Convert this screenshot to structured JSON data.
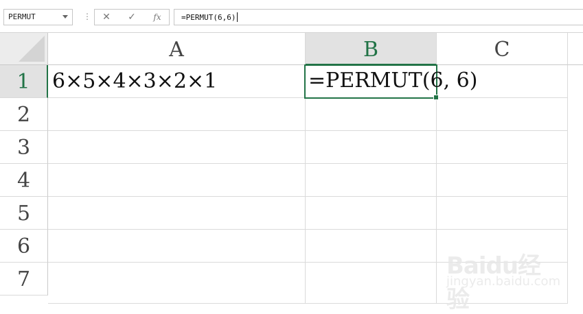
{
  "toolbar": {
    "name_box": "PERMUT",
    "cancel_glyph": "✕",
    "enter_glyph": "✓",
    "fx_label": "fx",
    "formula": "=PERMUT(6,6)"
  },
  "grid": {
    "columns": [
      "A",
      "B",
      "C"
    ],
    "rows": [
      "1",
      "2",
      "3",
      "4",
      "5",
      "6",
      "7"
    ],
    "active_column": "B",
    "active_row": "1",
    "cells": {
      "A1": "6×5×4×3×2×1",
      "B1": "=PERMUT(6, 6)"
    }
  },
  "watermark": {
    "logo": "Baidu经验",
    "site": "jingyan.baidu.com"
  },
  "colors": {
    "accent": "#217346",
    "header_active_bg": "#e2e2e2",
    "gridline": "#dadada"
  },
  "icons": [
    "chevron-down-icon",
    "cancel-icon",
    "check-icon",
    "fx-icon",
    "select-all-icon"
  ]
}
